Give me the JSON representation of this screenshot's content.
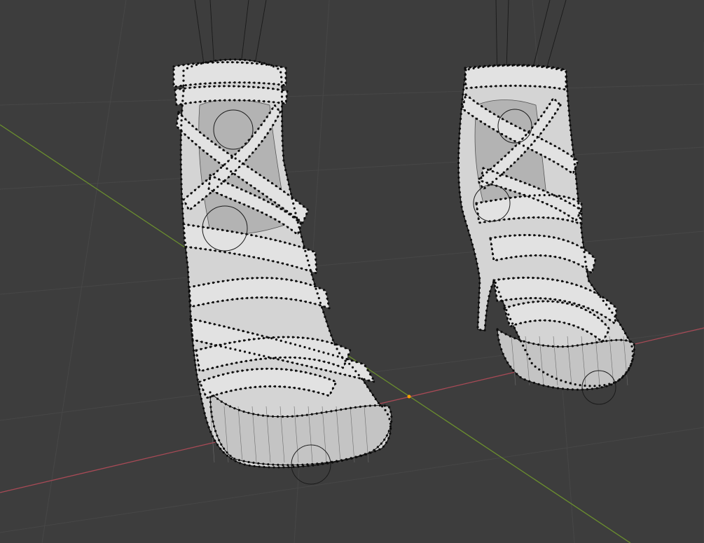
{
  "view": {
    "background": "#3d3d3d",
    "grid_color": "#474747",
    "x_axis_color": "#a84a56",
    "y_axis_color": "#6b8f2e",
    "origin_color": "#ffa000"
  },
  "models": [
    {
      "name": "left-sandal",
      "color": "#d4d4d4",
      "wire_color": "#111111"
    },
    {
      "name": "right-sandal",
      "color": "#d4d4d4",
      "wire_color": "#111111"
    }
  ],
  "rig": {
    "line_color": "#1a1a1a"
  }
}
